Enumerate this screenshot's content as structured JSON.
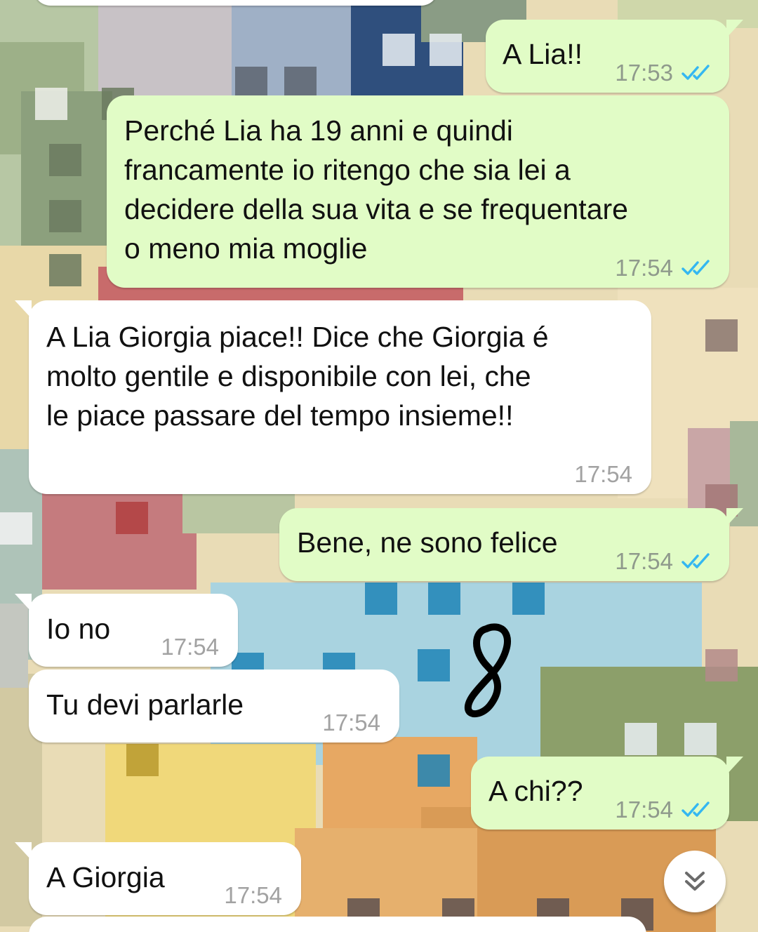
{
  "colors": {
    "outgoing_bubble": "#e1fcc6",
    "incoming_bubble": "#ffffff",
    "read_ticks": "#34b7f1",
    "timestamp": "#8f9a8c"
  },
  "messages": [
    {
      "id": "m1",
      "direction": "outgoing",
      "text": "A Lia!!",
      "time": "17:53",
      "status": "read"
    },
    {
      "id": "m2",
      "direction": "outgoing",
      "text": "Perché Lia ha 19 anni e quindi\nfrancamente io ritengo che sia lei a\ndecidere della sua vita e se frequentare\no meno mia moglie",
      "time": "17:54",
      "status": "read"
    },
    {
      "id": "m3",
      "direction": "incoming",
      "text": "A Lia Giorgia piace!! Dice che Giorgia é\nmolto gentile e disponibile con lei, che\nle piace passare del tempo insieme!!",
      "time": "17:54"
    },
    {
      "id": "m4",
      "direction": "outgoing",
      "text": "Bene, ne sono felice",
      "time": "17:54",
      "status": "read"
    },
    {
      "id": "m5",
      "direction": "incoming",
      "text": "Io no",
      "time": "17:54"
    },
    {
      "id": "m6",
      "direction": "incoming",
      "text": "Tu devi parlarle",
      "time": "17:54"
    },
    {
      "id": "m7",
      "direction": "outgoing",
      "text": "A chi??",
      "time": "17:54",
      "status": "read"
    },
    {
      "id": "m8",
      "direction": "incoming",
      "text": "A Giorgia",
      "time": "17:54"
    }
  ],
  "icons": {
    "read_receipt": "double-check-icon",
    "scroll_down": "chevron-double-down-icon",
    "overlay_doodle": "handwritten-8-doodle"
  }
}
